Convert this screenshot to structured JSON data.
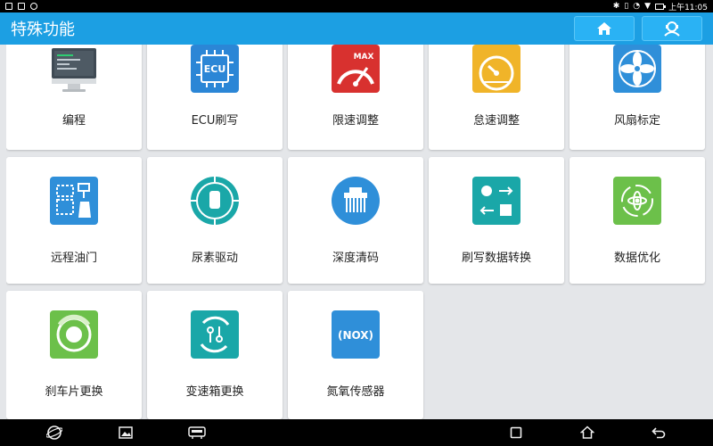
{
  "status_bar": {
    "time": "上午11:05"
  },
  "header": {
    "title": "特殊功能"
  },
  "tiles": [
    {
      "label": "编程",
      "icon": "monitor-icon"
    },
    {
      "label": "ECU刷写",
      "icon": "ecu-chip-icon"
    },
    {
      "label": "限速调整",
      "icon": "speed-limit-icon"
    },
    {
      "label": "怠速调整",
      "icon": "idle-gauge-icon"
    },
    {
      "label": "风扇标定",
      "icon": "fan-icon"
    },
    {
      "label": "远程油门",
      "icon": "remote-throttle-icon"
    },
    {
      "label": "尿素驱动",
      "icon": "urea-drive-icon"
    },
    {
      "label": "深度清码",
      "icon": "deep-clear-icon"
    },
    {
      "label": "刷写数据转换",
      "icon": "data-convert-icon"
    },
    {
      "label": "数据优化",
      "icon": "data-optimize-icon"
    },
    {
      "label": "刹车片更换",
      "icon": "brake-pad-icon"
    },
    {
      "label": "变速箱更换",
      "icon": "gearbox-icon"
    },
    {
      "label": "氮氧传感器",
      "icon": "nox-sensor-icon"
    }
  ],
  "icon_texts": {
    "ecu": "ECU",
    "max": "MAX",
    "nox": "(NOX)"
  },
  "colors": {
    "header": "#1c9fe3",
    "background": "#e4e6e9"
  }
}
